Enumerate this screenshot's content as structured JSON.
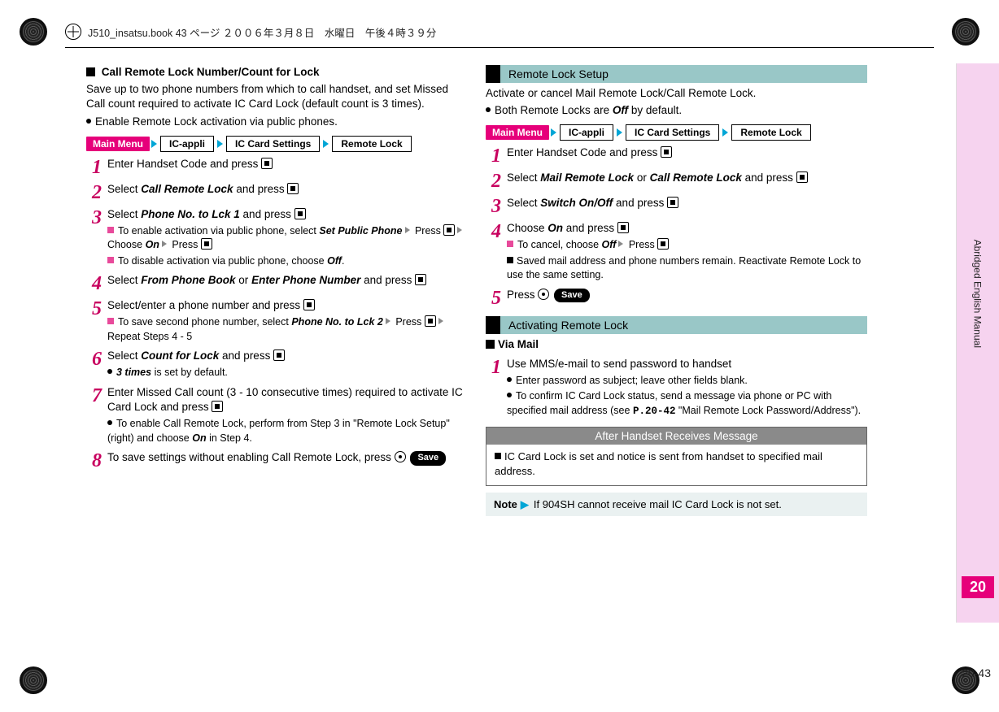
{
  "header": {
    "text": "J510_insatsu.book 43 ページ ２００６年３月８日　水曜日　午後４時３９分"
  },
  "side": {
    "vertical_label": "Abridged English Manual",
    "chapter": "20",
    "page_no": "20-43"
  },
  "left": {
    "h_title": "Call Remote Lock Number/Count for Lock",
    "intro1": "Save up to two phone numbers from which to call handset, and set Missed Call count required to activate IC Card Lock (default count is 3 times).",
    "bullet1": "Enable Remote Lock activation via public phones.",
    "menu": {
      "main": "Main Menu",
      "b1": "IC-appli",
      "b2": "IC Card Settings",
      "b3": "Remote Lock"
    },
    "s1": "Enter Handset Code and press ",
    "s2_pre": "Select ",
    "s2_em": "Call Remote Lock",
    "s2_post": " and press ",
    "s3_pre": "Select ",
    "s3_em": "Phone No. to Lck 1",
    "s3_post": " and press ",
    "s3_sub1_a": "To enable activation via public phone, select ",
    "s3_sub1_em1": "Set Public Phone",
    "s3_sub1_b": " Press ",
    "s3_sub1_c": " Choose ",
    "s3_sub1_em2": "On",
    "s3_sub1_d": " Press ",
    "s3_sub2_a": "To disable activation via public phone, choose ",
    "s3_sub2_em": "Off",
    "s3_sub2_b": ".",
    "s4_pre": "Select ",
    "s4_em1": "From Phone Book",
    "s4_mid": " or ",
    "s4_em2": "Enter Phone Number",
    "s4_post": " and press ",
    "s5_pre": "Select/enter a phone number and press ",
    "s5_sub_a": "To save second phone number, select ",
    "s5_sub_em": "Phone No. to Lck 2",
    "s5_sub_b": " Press ",
    "s5_sub_c": " Repeat Steps 4 - 5",
    "s6_pre": "Select ",
    "s6_em": "Count for Lock",
    "s6_post": " and press ",
    "s6_note_em": "3 times",
    "s6_note_post": " is set by default.",
    "s7_a": "Enter Missed Call count (3 - 10 consecutive times) required to activate IC Card Lock and press ",
    "s7_note_a": "To enable Call Remote Lock, perform from Step 3 in \"Remote Lock Setup\" (right) and choose ",
    "s7_note_em": "On",
    "s7_note_b": " in Step 4.",
    "s8_a": "To save settings without enabling Call Remote Lock, press ",
    "save": "Save"
  },
  "right": {
    "sec1": "Remote Lock Setup",
    "intro1": "Activate or cancel Mail Remote Lock/Call Remote Lock.",
    "bullet1_a": "Both Remote Locks are ",
    "bullet1_em": "Off",
    "bullet1_b": " by default.",
    "menu": {
      "main": "Main Menu",
      "b1": "IC-appli",
      "b2": "IC Card Settings",
      "b3": "Remote Lock"
    },
    "s1": "Enter Handset Code and press ",
    "s2_pre": "Select ",
    "s2_em1": "Mail Remote Lock",
    "s2_mid": " or ",
    "s2_em2": "Call Remote Lock",
    "s2_post": " and press ",
    "s3_pre": "Select ",
    "s3_em": "Switch On/Off",
    "s3_post": " and press ",
    "s4_pre": "Choose ",
    "s4_em": "On",
    "s4_post": " and press ",
    "s4_sub1_a": "To cancel, choose ",
    "s4_sub1_em": "Off",
    "s4_sub1_b": " Press ",
    "s4_sub2": "Saved mail address and phone numbers remain. Reactivate Remote Lock to use the same setting.",
    "s5_pre": "Press ",
    "save": "Save",
    "sec2": "Activating Remote Lock",
    "via_mail": "Via Mail",
    "vm_s1": "Use MMS/e-mail to send password to handset",
    "vm_b1": "Enter password as subject; leave other fields blank.",
    "vm_b2_a": "To confirm IC Card Lock status, send a message via phone or PC with specified mail address (see ",
    "vm_b2_ref": "P.20-42",
    "vm_b2_b": " \"Mail Remote Lock Password/Address\").",
    "box_title": "After Handset Receives Message",
    "box_body": "IC Card Lock is set and notice is sent from handset to specified mail address.",
    "note_label": "Note",
    "note_body": "If 904SH cannot receive mail IC Card Lock is not set."
  }
}
